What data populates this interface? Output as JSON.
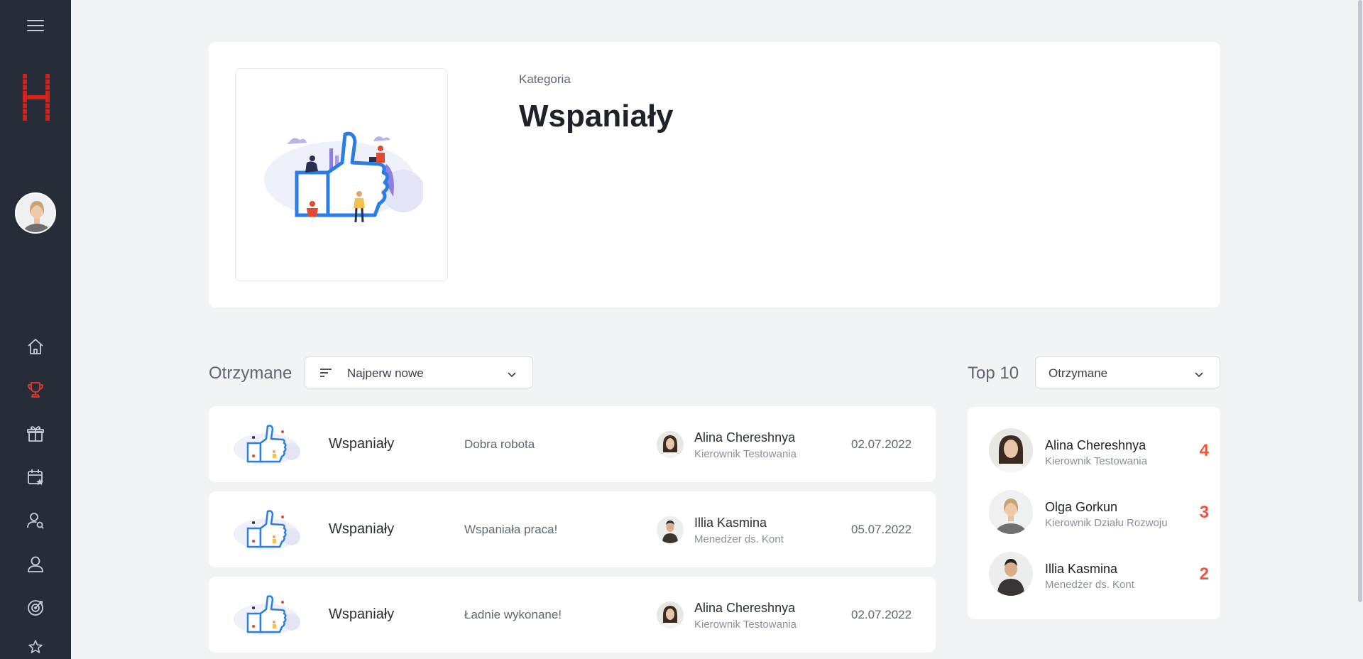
{
  "colors": {
    "sidebar_bg": "#272d38",
    "accent": "#f0543a",
    "page_bg": "#f2f3f5"
  },
  "sidebar": {
    "menu_icon": "hamburger-icon",
    "items": [
      {
        "icon": "home-icon"
      },
      {
        "icon": "trophy-icon",
        "active": true
      },
      {
        "icon": "gift-icon"
      },
      {
        "icon": "calendar-star-icon"
      },
      {
        "icon": "user-search-icon"
      },
      {
        "icon": "user-icon"
      },
      {
        "icon": "target-icon"
      },
      {
        "icon": "stars-icon"
      }
    ]
  },
  "header": {
    "category_label": "Kategoria",
    "category_title": "Wspaniały"
  },
  "received": {
    "title": "Otrzymane",
    "sort_label": "Najperw nowe",
    "items": [
      {
        "category": "Wspaniały",
        "message": "Dobra robota",
        "user": "Alina Chereshnya",
        "role": "Kierownik Testowania",
        "date": "02.07.2022"
      },
      {
        "category": "Wspaniały",
        "message": "Wspaniała praca!",
        "user": "Illia Kasmina",
        "role": "Menedżer ds. Kont",
        "date": "05.07.2022"
      },
      {
        "category": "Wspaniały",
        "message": "Ładnie wykonane!",
        "user": "Alina Chereshnya",
        "role": "Kierownik Testowania",
        "date": "02.07.2022"
      }
    ]
  },
  "top10": {
    "title": "Top 10",
    "filter_label": "Otrzymane",
    "items": [
      {
        "user": "Alina Chereshnya",
        "role": "Kierownik Testowania",
        "count": "4"
      },
      {
        "user": "Olga Gorkun",
        "role": "Kierownik Działu Rozwoju",
        "count": "3"
      },
      {
        "user": "Illia Kasmina",
        "role": "Menedżer ds. Kont",
        "count": "2"
      }
    ]
  }
}
